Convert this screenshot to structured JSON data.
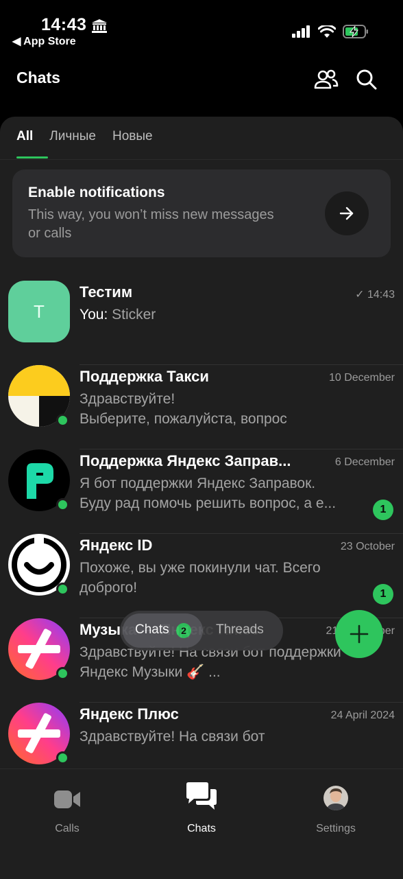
{
  "status_bar": {
    "time": "14:43",
    "back_label": "◀ App Store"
  },
  "header": {
    "title": "Chats"
  },
  "tabs": [
    {
      "label": "All",
      "active": true
    },
    {
      "label": "Личные",
      "active": false
    },
    {
      "label": "Новые",
      "active": false
    }
  ],
  "notification": {
    "title": "Enable notifications",
    "text": "This way, you won’t miss new messages or calls"
  },
  "chats": [
    {
      "name": "Тестим",
      "date": "14:43",
      "prefix": "You:",
      "line1": " Sticker",
      "line2": "",
      "unread": null
    },
    {
      "name": "Поддержка Такси",
      "date": "10 December",
      "line1": "Здравствуйте!",
      "line2": "Выберите, пожалуйста, вопрос",
      "unread": null
    },
    {
      "name": "Поддержка Яндекс Заправ...",
      "date": "6 December",
      "line1": "Я бот поддержки Яндекс Заправок.",
      "line2": "Буду рад помочь решить вопрос, а е...",
      "unread": "1"
    },
    {
      "name": "Яндекс ID",
      "date": "23 October",
      "line1": "Похоже, вы уже покинули чат. Всего",
      "line2": "доброго!",
      "unread": "1"
    },
    {
      "name": "Музыка — Яндекс Плюс",
      "date": "21 September",
      "line1": "Здравствуйте! На связи бот поддержки",
      "line2": "Яндекс Музыки 🎸 ...",
      "unread": null
    },
    {
      "name": "Яндекс Плюс",
      "date": "24 April 2024",
      "line1": "Здравствуйте! На связи бот",
      "line2": "",
      "unread": null
    }
  ],
  "switcher": {
    "chats_label": "Chats",
    "chats_count": "2",
    "threads_label": "Threads"
  },
  "bottom_nav": [
    {
      "label": "Calls",
      "icon": "video-camera-icon"
    },
    {
      "label": "Chats",
      "icon": "chat-bubbles-icon"
    },
    {
      "label": "Settings",
      "icon": "profile-avatar"
    }
  ],
  "colors": {
    "accent": "#2ec55d",
    "panel": "#1f1f1f",
    "card": "#2c2c2e",
    "muted": "#9b9b9b"
  }
}
